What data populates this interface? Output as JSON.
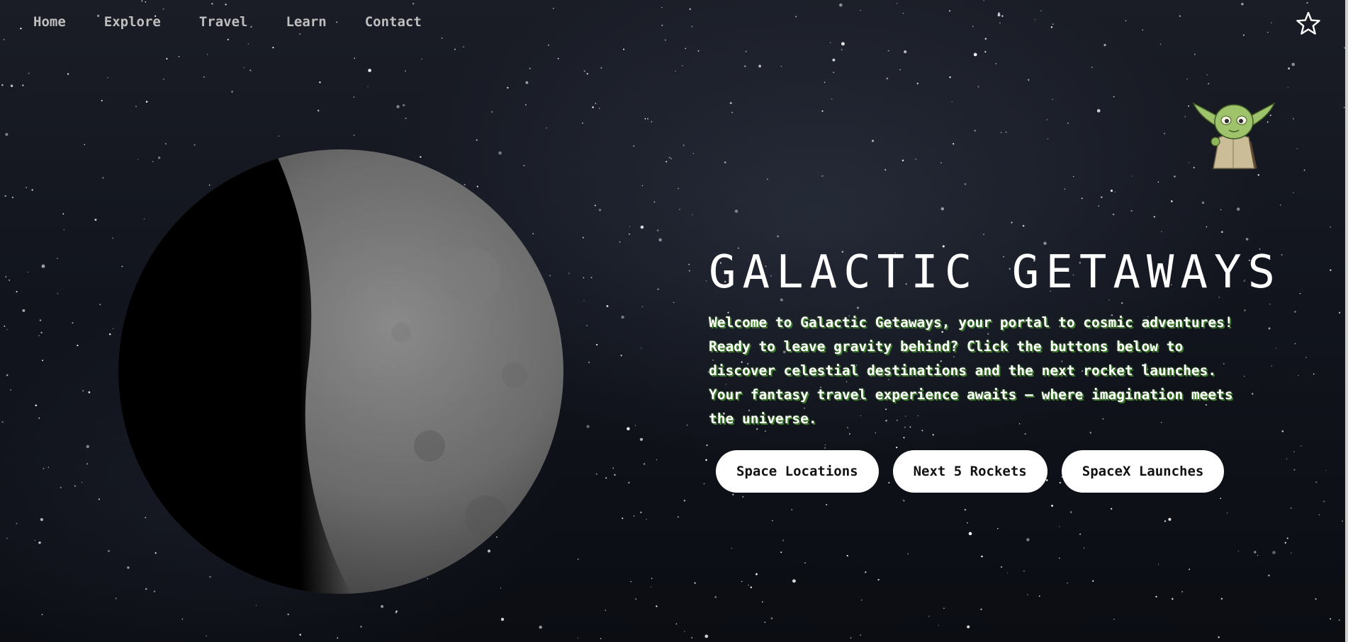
{
  "nav": {
    "items": [
      {
        "label": "Home"
      },
      {
        "label": "Explore"
      },
      {
        "label": "Travel"
      },
      {
        "label": "Learn"
      },
      {
        "label": "Contact"
      }
    ],
    "favorite_icon": "star-outline-icon"
  },
  "mascot": {
    "icon": "yoda-mascot"
  },
  "hero": {
    "title": "GALACTIC GETAWAYS",
    "description": "Welcome to Galactic Getaways, your portal to cosmic adventures! Ready to leave gravity behind? Click the buttons below to discover celestial destinations and the next rocket launches. Your fantasy travel experience awaits — where imagination meets the universe.",
    "buttons": [
      {
        "label": "Space Locations"
      },
      {
        "label": "Next 5 Rockets"
      },
      {
        "label": "SpaceX Launches"
      }
    ]
  },
  "colors": {
    "background": "#0d1018",
    "nav_text": "#bfbfbf",
    "title": "#ffffff",
    "description_glow": "#3c7a2a",
    "button_bg": "#ffffff",
    "button_text": "#111111"
  }
}
